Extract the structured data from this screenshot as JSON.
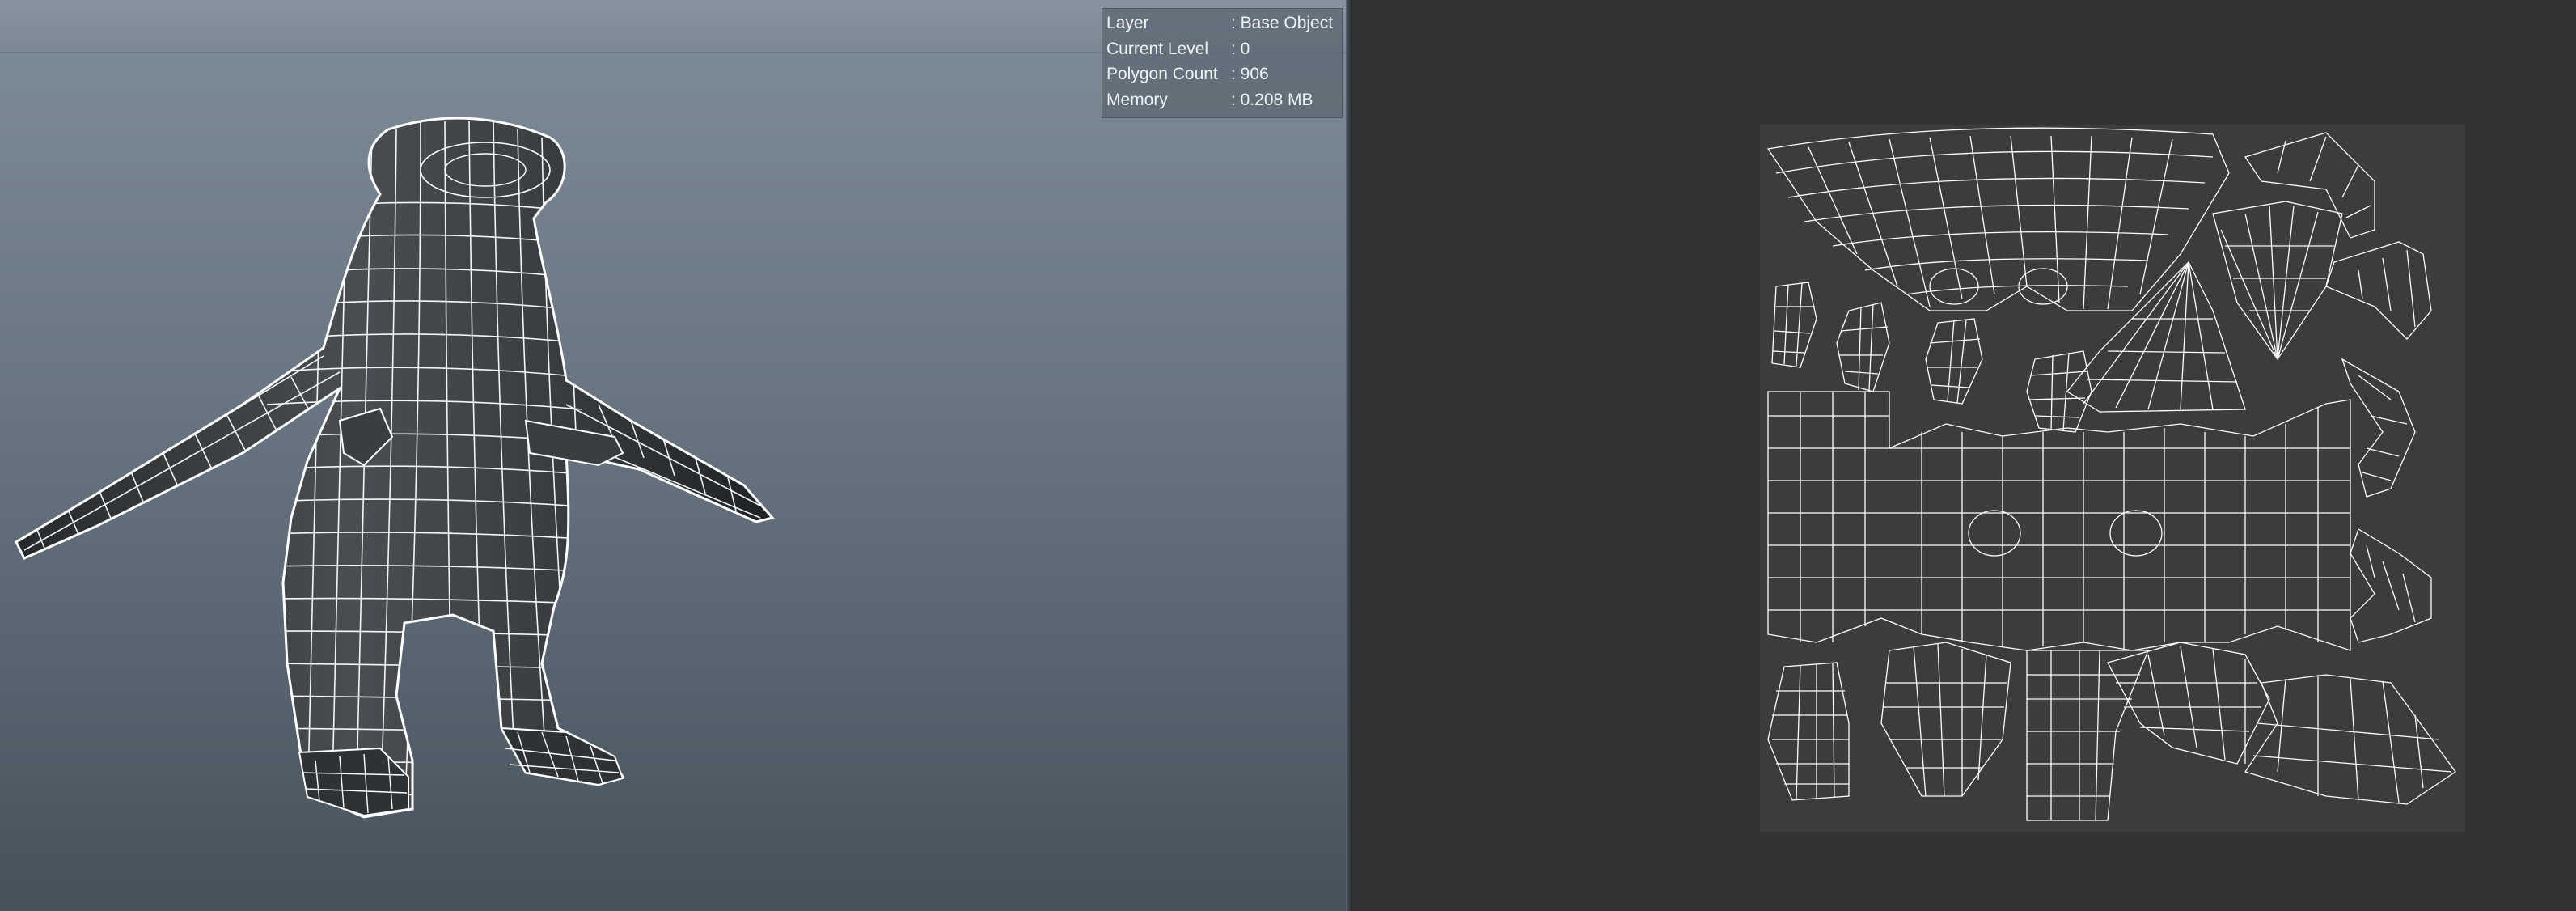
{
  "hud": {
    "rows": [
      {
        "label": "Layer",
        "value": ": Base Object"
      },
      {
        "label": "Current Level",
        "value": ": 0"
      },
      {
        "label": "Polygon Count",
        "value": ": 906"
      },
      {
        "label": "Memory",
        "value": ": 0.208 MB"
      }
    ]
  },
  "colors": {
    "viewport_top": "#7f8d99",
    "viewport_bottom": "#46515b",
    "uv_background": "#333333",
    "uv_tile": "#3c3c3c",
    "wire": "#ffffff",
    "mesh_fill": "#3a3d41"
  }
}
